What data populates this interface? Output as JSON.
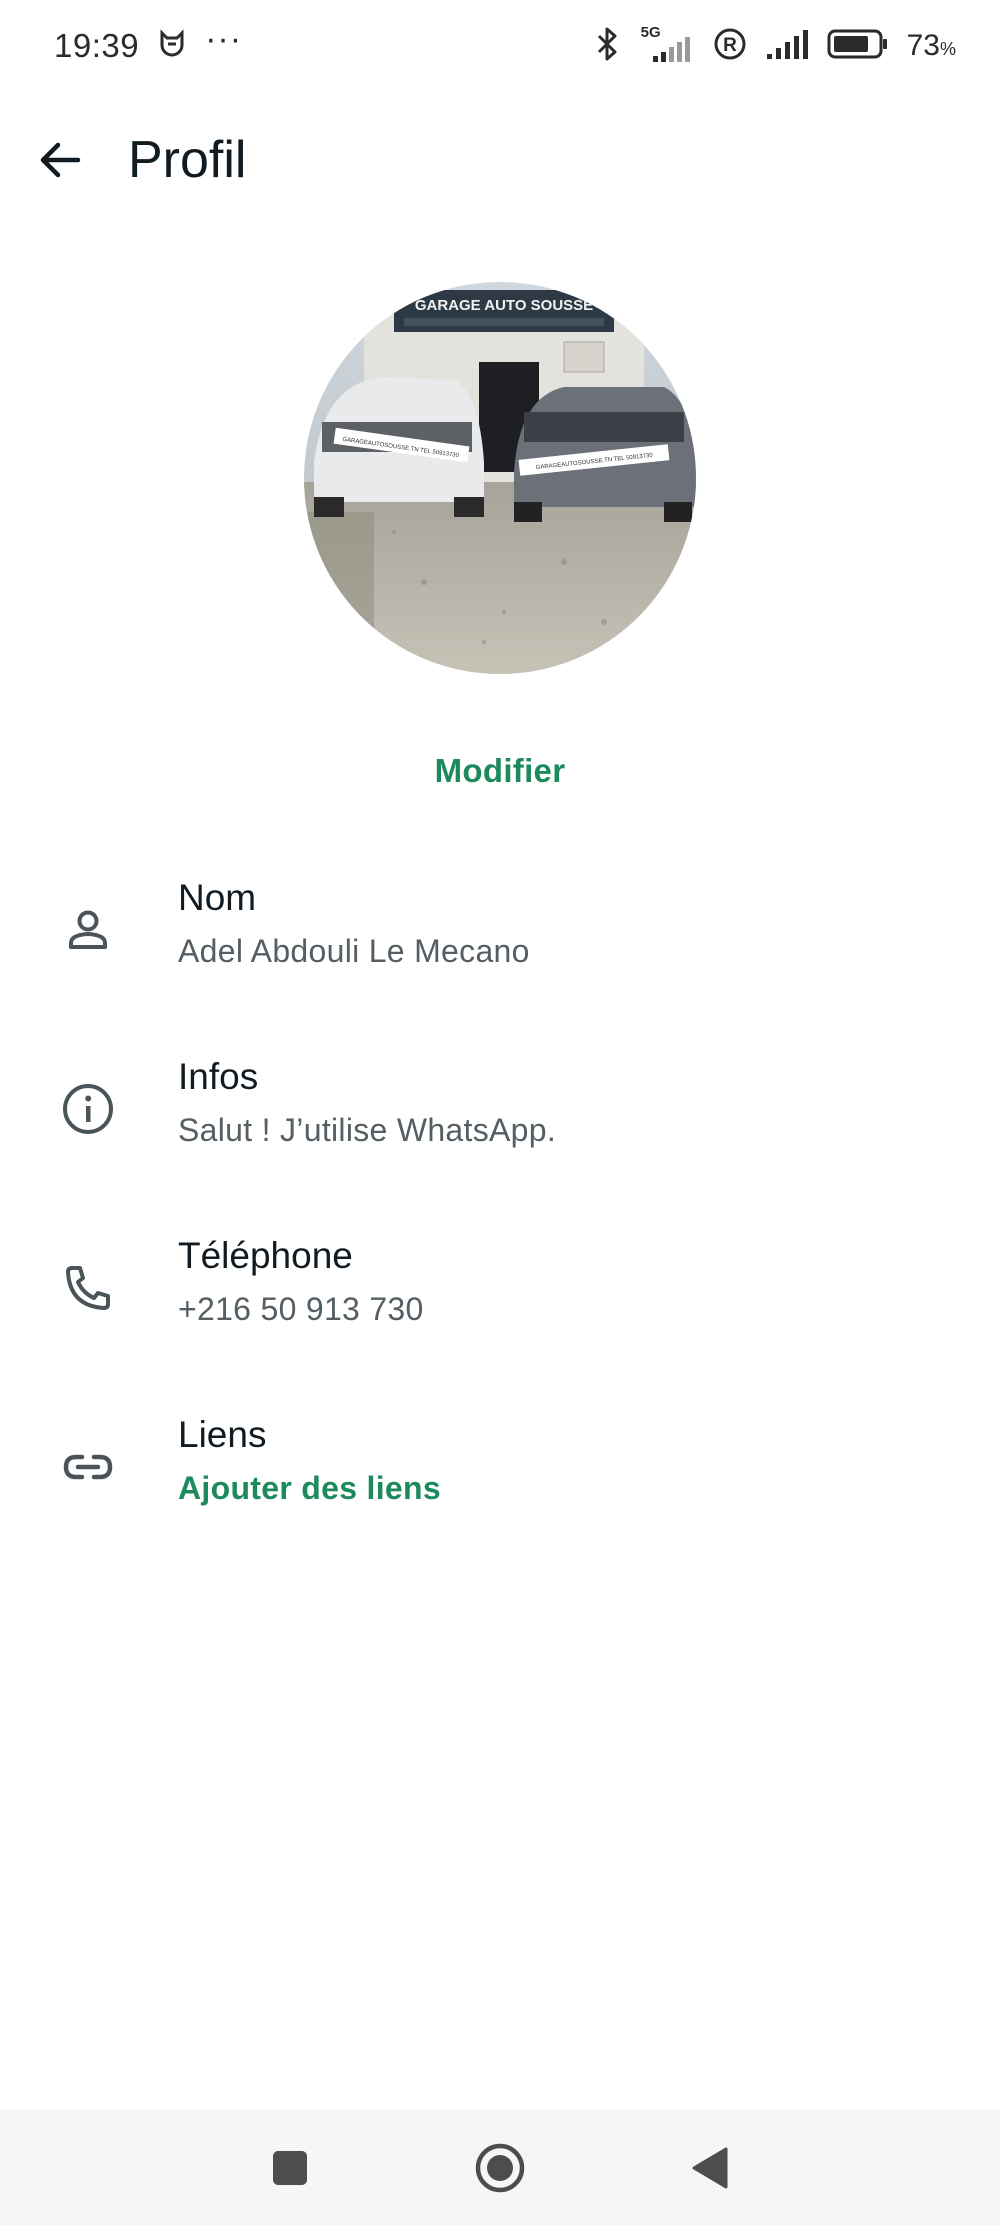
{
  "status_bar": {
    "time": "19:39",
    "dots": "···",
    "network": "5G",
    "battery_pct": "73",
    "battery_unit": "%"
  },
  "header": {
    "title": "Profil",
    "back_icon": "arrow-left-icon"
  },
  "profile": {
    "photo_banner": "GARAGE AUTO SOUSSE",
    "photo_sticker_left": "GARAGEAUTOSOUSSE.TN TEL 50913730",
    "photo_sticker_right": "GARAGEAUTOSOUSSE.TN TEL 50913730",
    "edit_label": "Modifier"
  },
  "fields": [
    {
      "icon": "person-icon",
      "label": "Nom",
      "value": "Adel Abdouli Le Mecano"
    },
    {
      "icon": "info-icon",
      "label": "Infos",
      "value": "Salut ! J’utilise WhatsApp."
    },
    {
      "icon": "phone-icon",
      "label": "Téléphone",
      "value": "+216 50 913 730"
    },
    {
      "icon": "link-icon",
      "label": "Liens",
      "value": "Ajouter des liens"
    }
  ],
  "nav": {
    "icons": [
      "recents-icon",
      "home-icon",
      "back-icon"
    ]
  },
  "colors": {
    "accent": "#1c8a5c",
    "text_primary": "#111b21",
    "text_secondary": "#545e63",
    "icon": "#4a5459"
  }
}
